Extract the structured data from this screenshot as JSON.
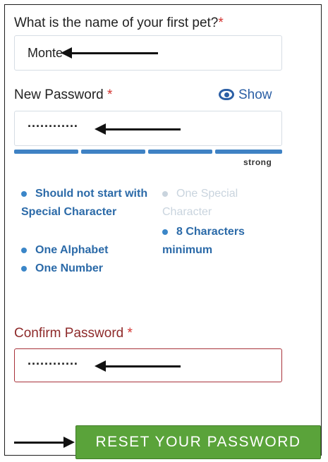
{
  "security_question": {
    "label": "What is the name of your first pet?",
    "required_mark": "*",
    "value": "Monte"
  },
  "new_password": {
    "label": "New Password",
    "required_mark": "*",
    "masked_value": "············",
    "show_label": "Show"
  },
  "strength": {
    "label": "strong",
    "segments_filled": 4,
    "segments_total": 4,
    "color": "#3f82c4"
  },
  "rules": {
    "left": [
      {
        "text": "Should not start with Special Character",
        "met": true
      },
      {
        "text": "One Alphabet",
        "met": true
      },
      {
        "text": "One Number",
        "met": true
      }
    ],
    "right": [
      {
        "text": "One Special Character",
        "met": false
      },
      {
        "text": "8 Characters minimum",
        "met": true
      }
    ]
  },
  "confirm_password": {
    "label": "Confirm Password",
    "required_mark": "*",
    "masked_value": "············"
  },
  "reset_button": {
    "label": "RESET YOUR PASSWORD",
    "color": "#5aa33a"
  },
  "colors": {
    "accent": "#2b5fa5",
    "error_border": "#a8323a",
    "required": "#d3322f"
  }
}
